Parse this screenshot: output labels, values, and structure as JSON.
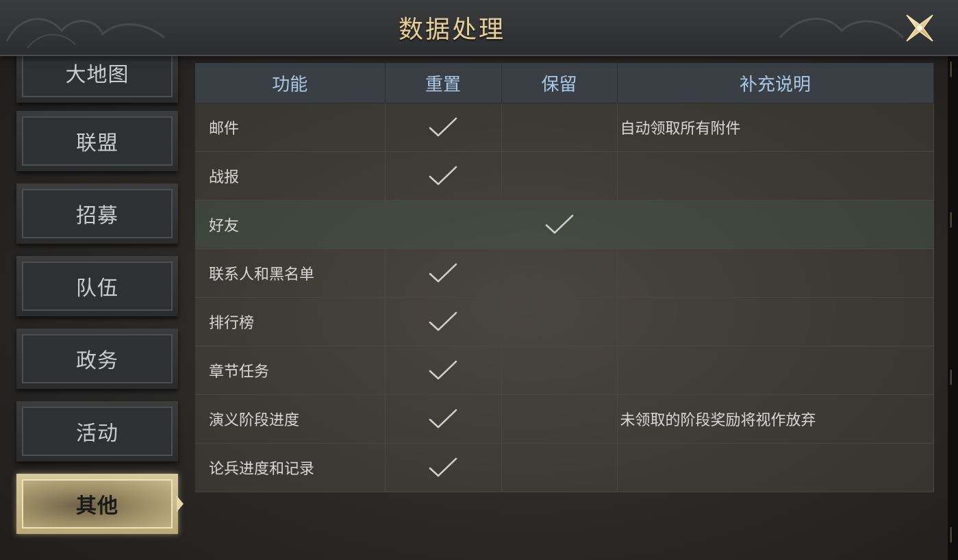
{
  "header": {
    "title": "数据处理"
  },
  "sidebar": {
    "items": [
      {
        "label": "大地图"
      },
      {
        "label": "联盟"
      },
      {
        "label": "招募"
      },
      {
        "label": "队伍"
      },
      {
        "label": "政务"
      },
      {
        "label": "活动"
      },
      {
        "label": "其他",
        "active": true
      }
    ]
  },
  "table": {
    "headers": {
      "function": "功能",
      "reset": "重置",
      "keep": "保留",
      "note": "补充说明"
    },
    "rows": [
      {
        "function": "邮件",
        "reset": true,
        "keep": false,
        "note": "自动领取所有附件"
      },
      {
        "function": "战报",
        "reset": true,
        "keep": false,
        "note": ""
      },
      {
        "function": "好友",
        "reset": false,
        "keep": true,
        "note": "",
        "highlighted": true
      },
      {
        "function": "联系人和黑名单",
        "reset": true,
        "keep": false,
        "note": ""
      },
      {
        "function": "排行榜",
        "reset": true,
        "keep": false,
        "note": ""
      },
      {
        "function": "章节任务",
        "reset": true,
        "keep": false,
        "note": ""
      },
      {
        "function": "演义阶段进度",
        "reset": true,
        "keep": false,
        "note": "未领取的阶段奖励将视作放弃"
      },
      {
        "function": "论兵进度和记录",
        "reset": true,
        "keep": false,
        "note": ""
      }
    ]
  },
  "colors": {
    "title": "#e7cf95",
    "header_text": "#a9c8e6",
    "active_tab": "#d6c99e",
    "check": "#d0d0d0"
  },
  "icons": {
    "close": "close-x-icon",
    "check": "checkmark-icon"
  }
}
